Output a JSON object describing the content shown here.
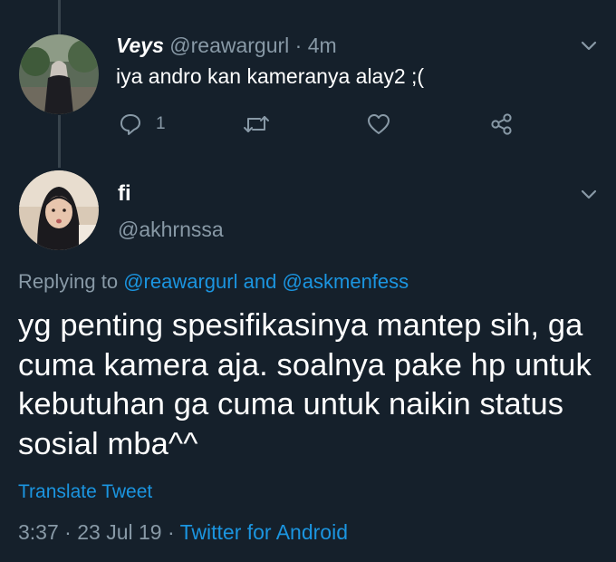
{
  "parent_tweet": {
    "display_name": "Veys",
    "handle": "@reawargurl",
    "separator": "·",
    "time": "4m",
    "text": "iya andro kan kameranya alay2 ;(",
    "reply_count": "1",
    "avatar_icon": "user-avatar-photo"
  },
  "main_tweet": {
    "display_name": "fi",
    "handle": "@akhrnssa",
    "replying": {
      "prefix": "Replying to",
      "user1": "@reawargurl",
      "conjunction": "and",
      "user2": "@askmenfess"
    },
    "text_lines": [
      "yg penting spesifikasinya mantep sih, ga",
      "cuma kamera aja. soalnya pake hp untuk",
      "kebutuhan ga cuma untuk naikin status",
      "sosial mba^^"
    ],
    "translate_label": "Translate Tweet",
    "time": "3:37",
    "date": "23 Jul 19",
    "separator": "·",
    "source": "Twitter for Android"
  },
  "colors": {
    "background": "#15202b",
    "muted_text": "#8899a6",
    "link": "#1b95e0",
    "thread_line": "#38444d"
  }
}
